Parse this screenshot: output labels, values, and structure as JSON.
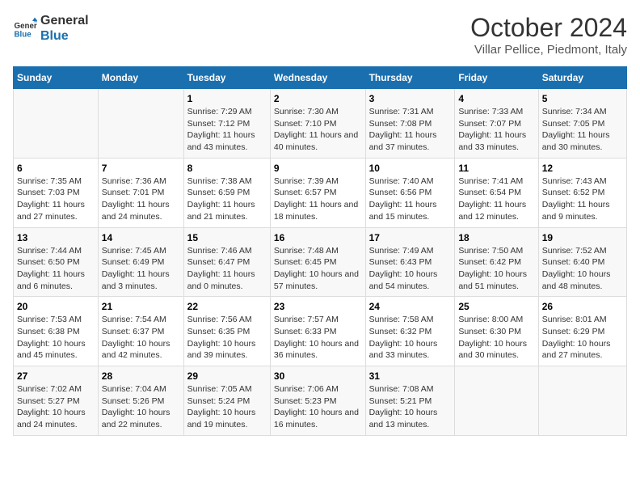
{
  "header": {
    "logo_line1": "General",
    "logo_line2": "Blue",
    "month": "October 2024",
    "location": "Villar Pellice, Piedmont, Italy"
  },
  "weekdays": [
    "Sunday",
    "Monday",
    "Tuesday",
    "Wednesday",
    "Thursday",
    "Friday",
    "Saturday"
  ],
  "weeks": [
    [
      {
        "day": "",
        "info": ""
      },
      {
        "day": "",
        "info": ""
      },
      {
        "day": "1",
        "info": "Sunrise: 7:29 AM\nSunset: 7:12 PM\nDaylight: 11 hours and 43 minutes."
      },
      {
        "day": "2",
        "info": "Sunrise: 7:30 AM\nSunset: 7:10 PM\nDaylight: 11 hours and 40 minutes."
      },
      {
        "day": "3",
        "info": "Sunrise: 7:31 AM\nSunset: 7:08 PM\nDaylight: 11 hours and 37 minutes."
      },
      {
        "day": "4",
        "info": "Sunrise: 7:33 AM\nSunset: 7:07 PM\nDaylight: 11 hours and 33 minutes."
      },
      {
        "day": "5",
        "info": "Sunrise: 7:34 AM\nSunset: 7:05 PM\nDaylight: 11 hours and 30 minutes."
      }
    ],
    [
      {
        "day": "6",
        "info": "Sunrise: 7:35 AM\nSunset: 7:03 PM\nDaylight: 11 hours and 27 minutes."
      },
      {
        "day": "7",
        "info": "Sunrise: 7:36 AM\nSunset: 7:01 PM\nDaylight: 11 hours and 24 minutes."
      },
      {
        "day": "8",
        "info": "Sunrise: 7:38 AM\nSunset: 6:59 PM\nDaylight: 11 hours and 21 minutes."
      },
      {
        "day": "9",
        "info": "Sunrise: 7:39 AM\nSunset: 6:57 PM\nDaylight: 11 hours and 18 minutes."
      },
      {
        "day": "10",
        "info": "Sunrise: 7:40 AM\nSunset: 6:56 PM\nDaylight: 11 hours and 15 minutes."
      },
      {
        "day": "11",
        "info": "Sunrise: 7:41 AM\nSunset: 6:54 PM\nDaylight: 11 hours and 12 minutes."
      },
      {
        "day": "12",
        "info": "Sunrise: 7:43 AM\nSunset: 6:52 PM\nDaylight: 11 hours and 9 minutes."
      }
    ],
    [
      {
        "day": "13",
        "info": "Sunrise: 7:44 AM\nSunset: 6:50 PM\nDaylight: 11 hours and 6 minutes."
      },
      {
        "day": "14",
        "info": "Sunrise: 7:45 AM\nSunset: 6:49 PM\nDaylight: 11 hours and 3 minutes."
      },
      {
        "day": "15",
        "info": "Sunrise: 7:46 AM\nSunset: 6:47 PM\nDaylight: 11 hours and 0 minutes."
      },
      {
        "day": "16",
        "info": "Sunrise: 7:48 AM\nSunset: 6:45 PM\nDaylight: 10 hours and 57 minutes."
      },
      {
        "day": "17",
        "info": "Sunrise: 7:49 AM\nSunset: 6:43 PM\nDaylight: 10 hours and 54 minutes."
      },
      {
        "day": "18",
        "info": "Sunrise: 7:50 AM\nSunset: 6:42 PM\nDaylight: 10 hours and 51 minutes."
      },
      {
        "day": "19",
        "info": "Sunrise: 7:52 AM\nSunset: 6:40 PM\nDaylight: 10 hours and 48 minutes."
      }
    ],
    [
      {
        "day": "20",
        "info": "Sunrise: 7:53 AM\nSunset: 6:38 PM\nDaylight: 10 hours and 45 minutes."
      },
      {
        "day": "21",
        "info": "Sunrise: 7:54 AM\nSunset: 6:37 PM\nDaylight: 10 hours and 42 minutes."
      },
      {
        "day": "22",
        "info": "Sunrise: 7:56 AM\nSunset: 6:35 PM\nDaylight: 10 hours and 39 minutes."
      },
      {
        "day": "23",
        "info": "Sunrise: 7:57 AM\nSunset: 6:33 PM\nDaylight: 10 hours and 36 minutes."
      },
      {
        "day": "24",
        "info": "Sunrise: 7:58 AM\nSunset: 6:32 PM\nDaylight: 10 hours and 33 minutes."
      },
      {
        "day": "25",
        "info": "Sunrise: 8:00 AM\nSunset: 6:30 PM\nDaylight: 10 hours and 30 minutes."
      },
      {
        "day": "26",
        "info": "Sunrise: 8:01 AM\nSunset: 6:29 PM\nDaylight: 10 hours and 27 minutes."
      }
    ],
    [
      {
        "day": "27",
        "info": "Sunrise: 7:02 AM\nSunset: 5:27 PM\nDaylight: 10 hours and 24 minutes."
      },
      {
        "day": "28",
        "info": "Sunrise: 7:04 AM\nSunset: 5:26 PM\nDaylight: 10 hours and 22 minutes."
      },
      {
        "day": "29",
        "info": "Sunrise: 7:05 AM\nSunset: 5:24 PM\nDaylight: 10 hours and 19 minutes."
      },
      {
        "day": "30",
        "info": "Sunrise: 7:06 AM\nSunset: 5:23 PM\nDaylight: 10 hours and 16 minutes."
      },
      {
        "day": "31",
        "info": "Sunrise: 7:08 AM\nSunset: 5:21 PM\nDaylight: 10 hours and 13 minutes."
      },
      {
        "day": "",
        "info": ""
      },
      {
        "day": "",
        "info": ""
      }
    ]
  ]
}
